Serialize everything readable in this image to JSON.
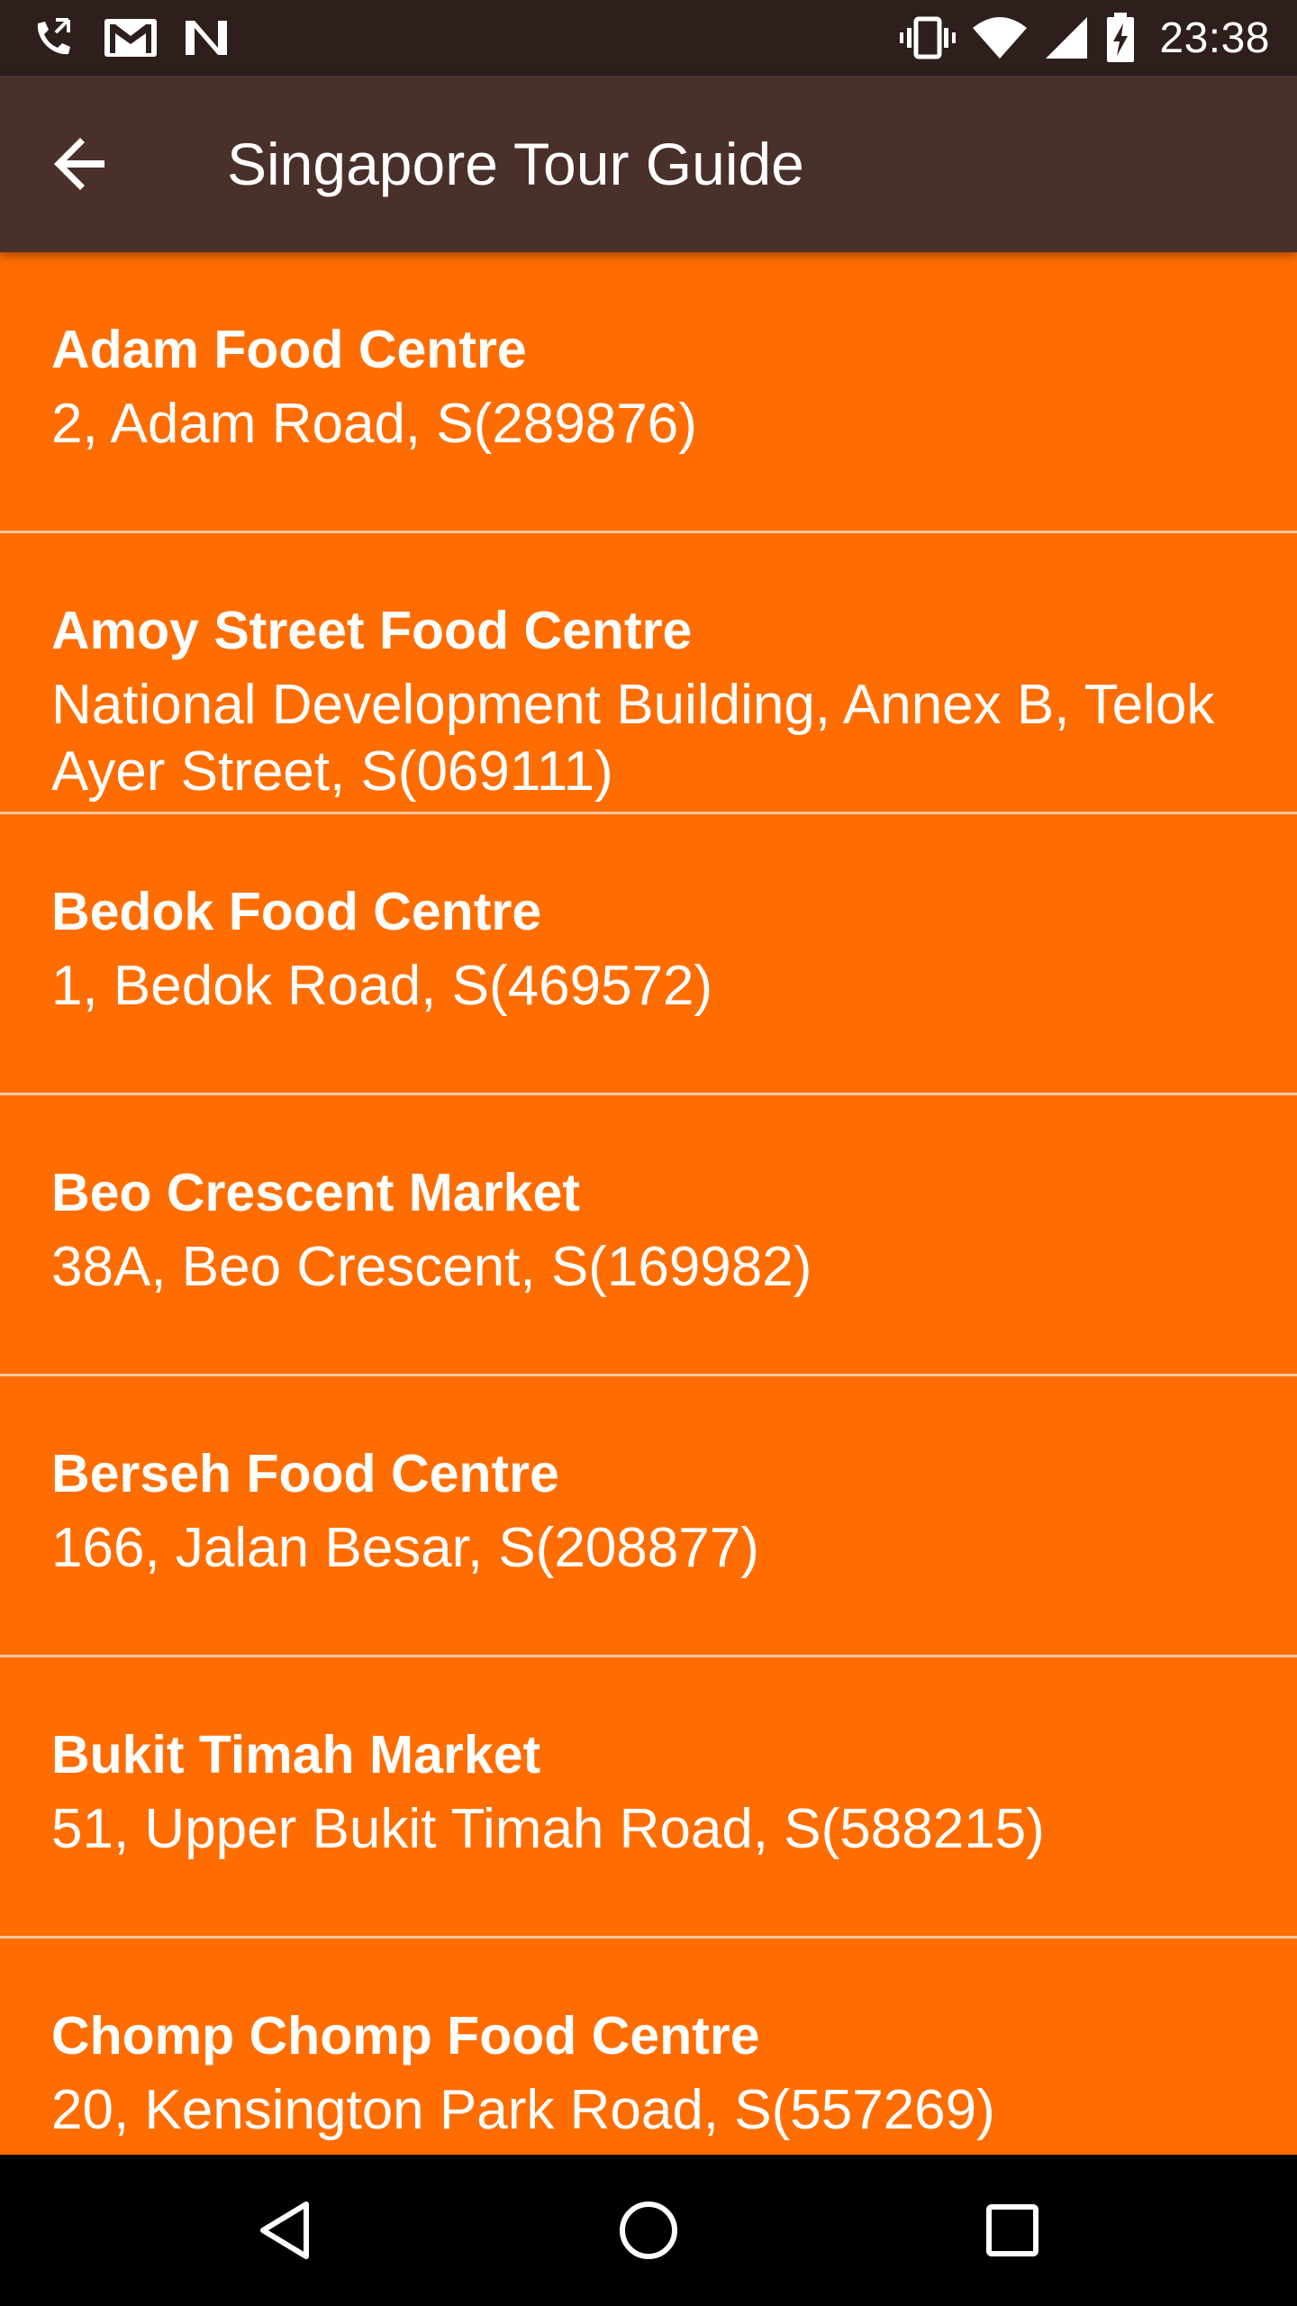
{
  "status_bar": {
    "time": "23:38",
    "left_icons": [
      "call-forwarding-icon",
      "gmail-icon",
      "n-notification-icon"
    ],
    "right_icons": [
      "vibrate-icon",
      "wifi-icon",
      "cell-signal-icon",
      "battery-charging-icon"
    ]
  },
  "app_bar": {
    "title": "Singapore Tour Guide",
    "back_icon": "arrow-back-icon"
  },
  "colors": {
    "status_bar": "#2e1f1c",
    "app_bar": "#4a302b",
    "list_background": "#ff6d00",
    "divider": "#ffc8a3",
    "text": "#ffffff",
    "nav_bar": "#000000"
  },
  "food_centres": [
    {
      "name": "Adam Food Centre",
      "address": "2, Adam Road, S(289876)"
    },
    {
      "name": "Amoy Street Food Centre",
      "address": "National Development Building, Annex B, Telok Ayer Street, S(069111)"
    },
    {
      "name": "Bedok Food Centre",
      "address": "1, Bedok Road, S(469572)"
    },
    {
      "name": "Beo Crescent Market",
      "address": "38A, Beo Crescent, S(169982)"
    },
    {
      "name": "Berseh Food Centre",
      "address": "166, Jalan Besar, S(208877)"
    },
    {
      "name": "Bukit Timah Market",
      "address": "51, Upper Bukit Timah Road, S(588215)"
    },
    {
      "name": "Chomp Chomp Food Centre",
      "address": "20, Kensington Park Road, S(557269)"
    }
  ],
  "nav_bar": {
    "buttons": [
      "back-triangle-icon",
      "home-circle-icon",
      "recents-square-icon"
    ]
  }
}
